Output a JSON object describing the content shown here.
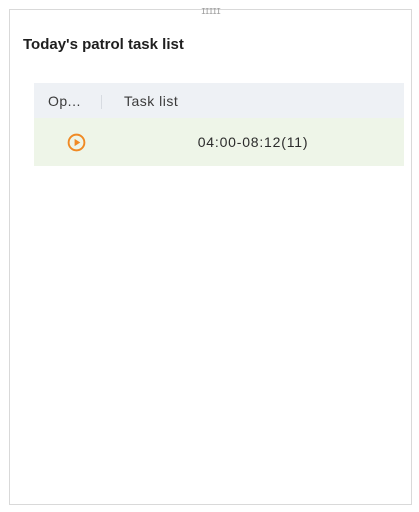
{
  "panel": {
    "title": "Today's patrol task list",
    "drag_handle": "IIIII"
  },
  "table": {
    "columns": {
      "operation": "Op...",
      "task_list": "Task list"
    },
    "rows": [
      {
        "action_icon": "play-circle-icon",
        "task": "04:00-08:12(11)"
      }
    ]
  },
  "colors": {
    "accent": "#f08a24",
    "header_bg": "#eef1f5",
    "row_bg": "#eef5e8"
  }
}
